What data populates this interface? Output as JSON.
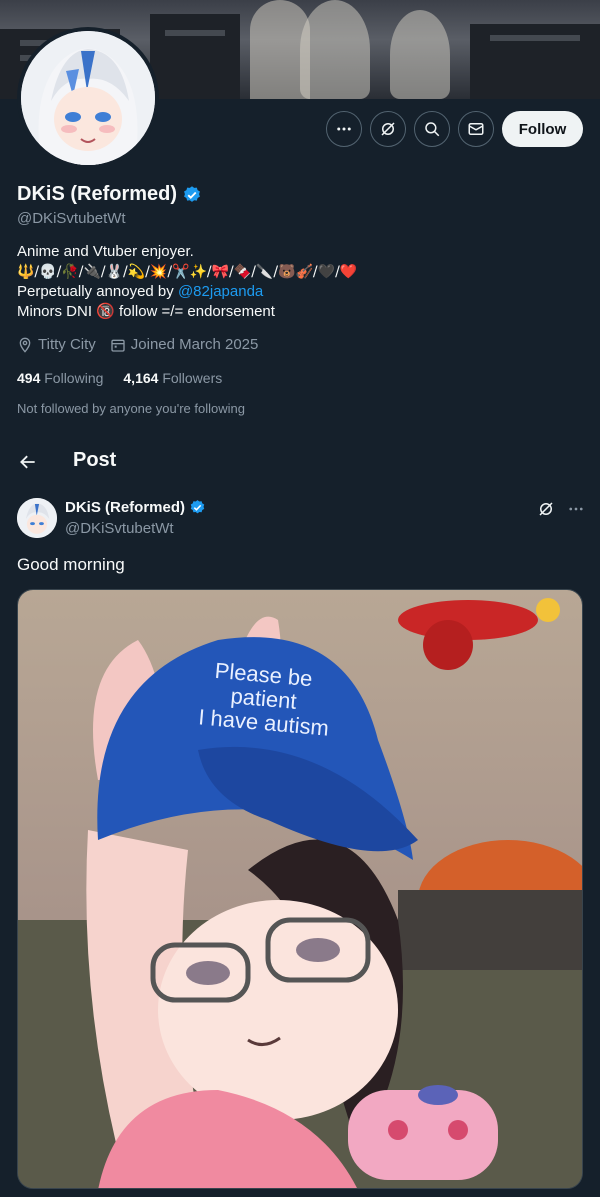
{
  "profile": {
    "display_name": "DKiS (Reformed)",
    "handle": "@DKiSvtubetWt",
    "verified": true,
    "bio_line1": "Anime and Vtuber enjoyer.",
    "bio_emoji_line": "🔱/💀/🥀/🔌/🐰/💫/💥/✂️✨/🎀/🍫/🔪/🐻🎻/🖤/❤️",
    "bio_annoyed_prefix": "Perpetually annoyed by ",
    "bio_annoyed_link": "@82japanda",
    "bio_minors": "Minors DNI 🔞 follow =/= endorsement",
    "location": "Titty City",
    "joined": "Joined March 2025",
    "following_count": "494",
    "following_label": "Following",
    "followers_count": "4,164",
    "followers_label": "Followers",
    "not_followed_text": "Not followed by anyone you're following"
  },
  "actions": {
    "follow_label": "Follow",
    "icons": [
      "more-icon",
      "grok-icon",
      "search-icon",
      "message-icon"
    ]
  },
  "post_header": {
    "title": "Post"
  },
  "tweet": {
    "author_name": "DKiS (Reformed)",
    "author_handle": "@DKiSvtubetWt",
    "text": "Good morning",
    "image_cap_text_line1": "Please be",
    "image_cap_text_line2": "patient",
    "image_cap_text_line3": "I have autism"
  },
  "colors": {
    "background": "#15202b",
    "accent": "#1d9bf0",
    "muted": "#8b98a5",
    "follow_bg": "#eff3f4"
  }
}
